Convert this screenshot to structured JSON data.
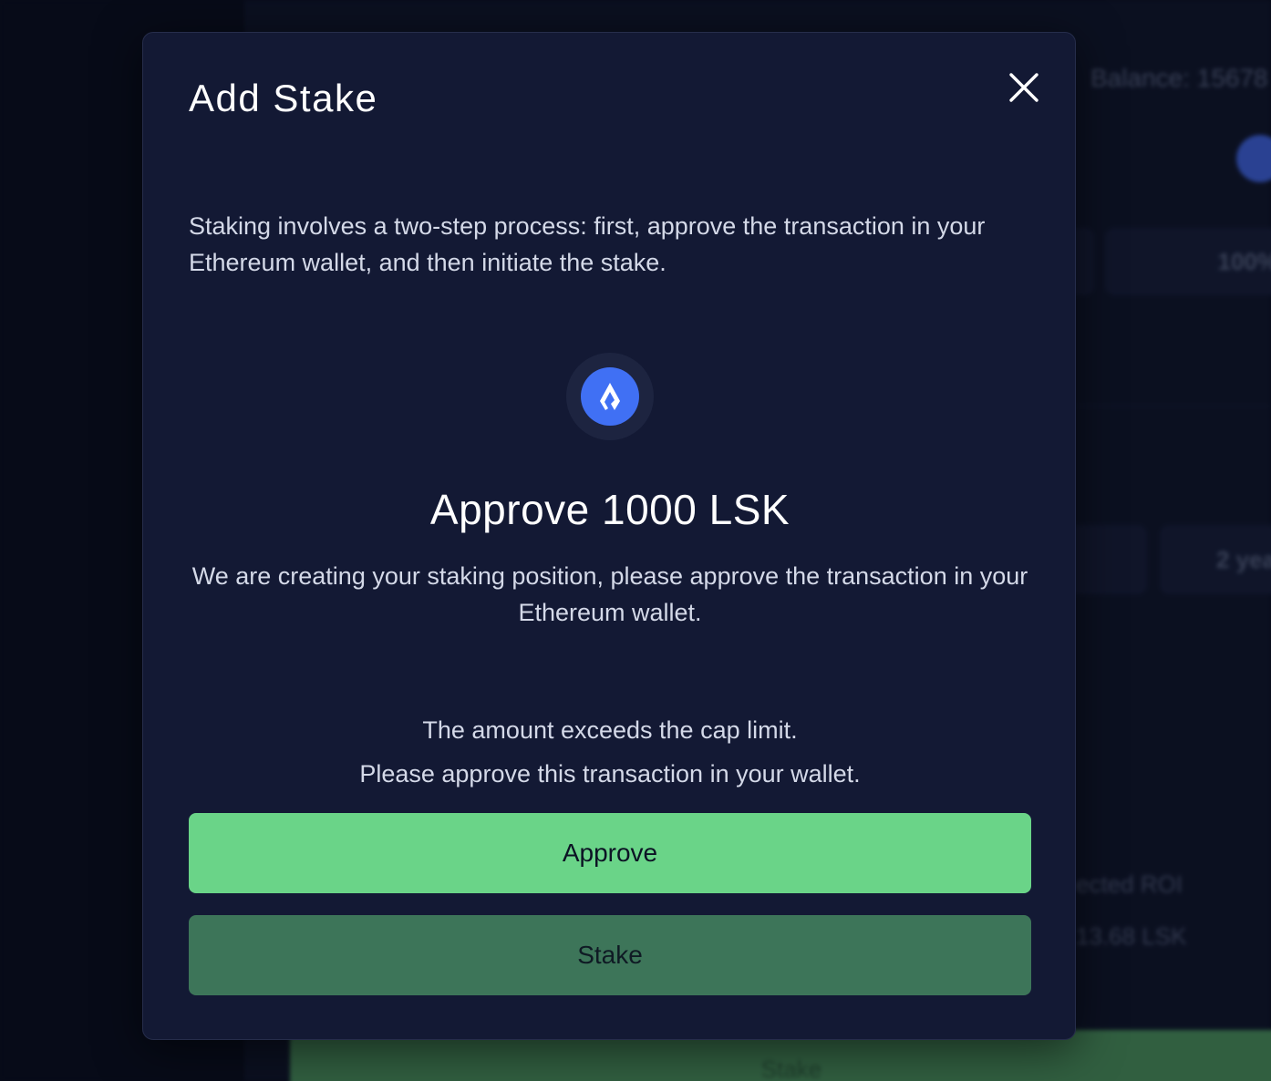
{
  "background": {
    "balance_label": "Balance: 15678",
    "percent_chip": "100%",
    "duration_chip": "2 yea",
    "roi_label": "ected ROI",
    "roi_value": "13.68 LSK",
    "stake_button": "Stake"
  },
  "modal": {
    "title": "Add Stake",
    "intro": "Staking involves a two-step process: first, approve the transaction in your Ethereum wallet, and then initiate the stake.",
    "token_icon": "lisk-token-icon",
    "approve_heading": "Approve 1000 LSK",
    "approve_description": "We are creating your staking position, please approve the transaction in your Ethereum wallet.",
    "cap_notice_line1": "The amount exceeds the cap limit.",
    "cap_notice_line2": "Please approve this transaction in your wallet.",
    "approve_button": "Approve",
    "stake_button": "Stake"
  },
  "colors": {
    "modal_bg": "#131934",
    "approve_green": "#6ad488",
    "stake_green_disabled": "#3d7559",
    "token_blue": "#4070f4"
  }
}
